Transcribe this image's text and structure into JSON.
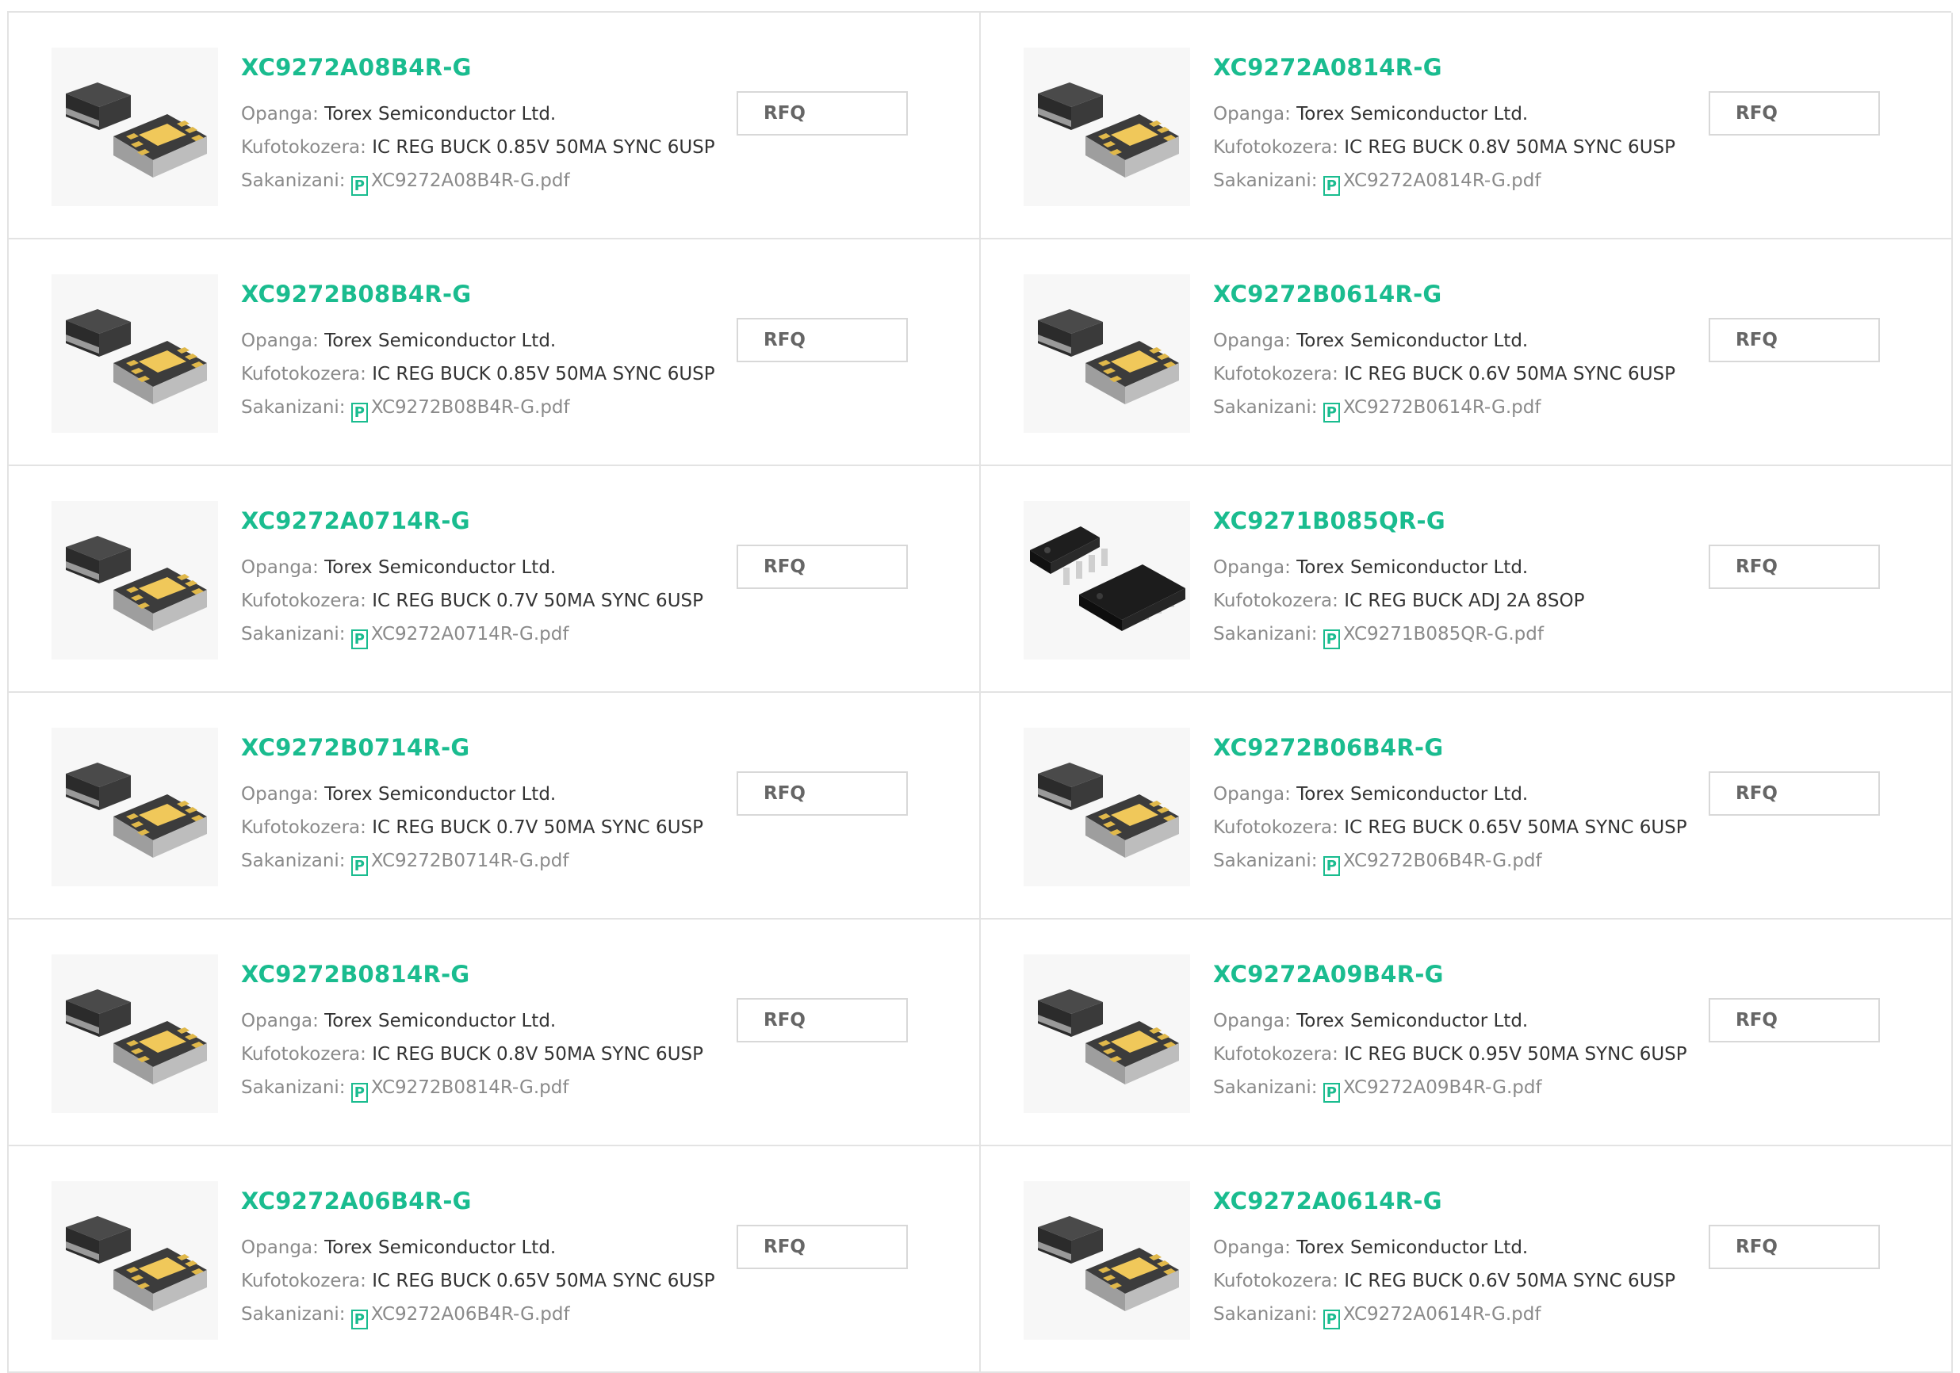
{
  "labels": {
    "manufacturer": "Opanga:",
    "description": "Kufotokozera:",
    "datasheet": "Sakanizani:",
    "rfq": "RFQ"
  },
  "products": [
    {
      "pn": "XC9272A08B4R-G",
      "manufacturer": "Torex Semiconductor Ltd.",
      "description": "IC REG BUCK 0.85V 50MA SYNC 6USP",
      "datasheet": "XC9272A08B4R-G.pdf",
      "package": "6USP"
    },
    {
      "pn": "XC9272A0814R-G",
      "manufacturer": "Torex Semiconductor Ltd.",
      "description": "IC REG BUCK 0.8V 50MA SYNC 6USP",
      "datasheet": "XC9272A0814R-G.pdf",
      "package": "6USP"
    },
    {
      "pn": "XC9272B08B4R-G",
      "manufacturer": "Torex Semiconductor Ltd.",
      "description": "IC REG BUCK 0.85V 50MA SYNC 6USP",
      "datasheet": "XC9272B08B4R-G.pdf",
      "package": "6USP"
    },
    {
      "pn": "XC9272B0614R-G",
      "manufacturer": "Torex Semiconductor Ltd.",
      "description": "IC REG BUCK 0.6V 50MA SYNC 6USP",
      "datasheet": "XC9272B0614R-G.pdf",
      "package": "6USP"
    },
    {
      "pn": "XC9272A0714R-G",
      "manufacturer": "Torex Semiconductor Ltd.",
      "description": "IC REG BUCK 0.7V 50MA SYNC 6USP",
      "datasheet": "XC9272A0714R-G.pdf",
      "package": "6USP"
    },
    {
      "pn": "XC9271B085QR-G",
      "manufacturer": "Torex Semiconductor Ltd.",
      "description": "IC REG BUCK ADJ 2A 8SOP",
      "datasheet": "XC9271B085QR-G.pdf",
      "package": "8SOP"
    },
    {
      "pn": "XC9272B0714R-G",
      "manufacturer": "Torex Semiconductor Ltd.",
      "description": "IC REG BUCK 0.7V 50MA SYNC 6USP",
      "datasheet": "XC9272B0714R-G.pdf",
      "package": "6USP"
    },
    {
      "pn": "XC9272B06B4R-G",
      "manufacturer": "Torex Semiconductor Ltd.",
      "description": "IC REG BUCK 0.65V 50MA SYNC 6USP",
      "datasheet": "XC9272B06B4R-G.pdf",
      "package": "6USP"
    },
    {
      "pn": "XC9272B0814R-G",
      "manufacturer": "Torex Semiconductor Ltd.",
      "description": "IC REG BUCK 0.8V 50MA SYNC 6USP",
      "datasheet": "XC9272B0814R-G.pdf",
      "package": "6USP"
    },
    {
      "pn": "XC9272A09B4R-G",
      "manufacturer": "Torex Semiconductor Ltd.",
      "description": "IC REG BUCK 0.95V 50MA SYNC 6USP",
      "datasheet": "XC9272A09B4R-G.pdf",
      "package": "6USP"
    },
    {
      "pn": "XC9272A06B4R-G",
      "manufacturer": "Torex Semiconductor Ltd.",
      "description": "IC REG BUCK 0.65V 50MA SYNC 6USP",
      "datasheet": "XC9272A06B4R-G.pdf",
      "package": "6USP"
    },
    {
      "pn": "XC9272A0614R-G",
      "manufacturer": "Torex Semiconductor Ltd.",
      "description": "IC REG BUCK 0.6V 50MA SYNC 6USP",
      "datasheet": "XC9272A0614R-G.pdf",
      "package": "6USP"
    }
  ],
  "colors": {
    "accent": "#1abc8f",
    "label": "#8a8a8a",
    "value": "#333333",
    "border": "#e3e3e3"
  },
  "icons": {
    "datasheet": "pdf-icon",
    "product_image": "chip-package-image"
  }
}
